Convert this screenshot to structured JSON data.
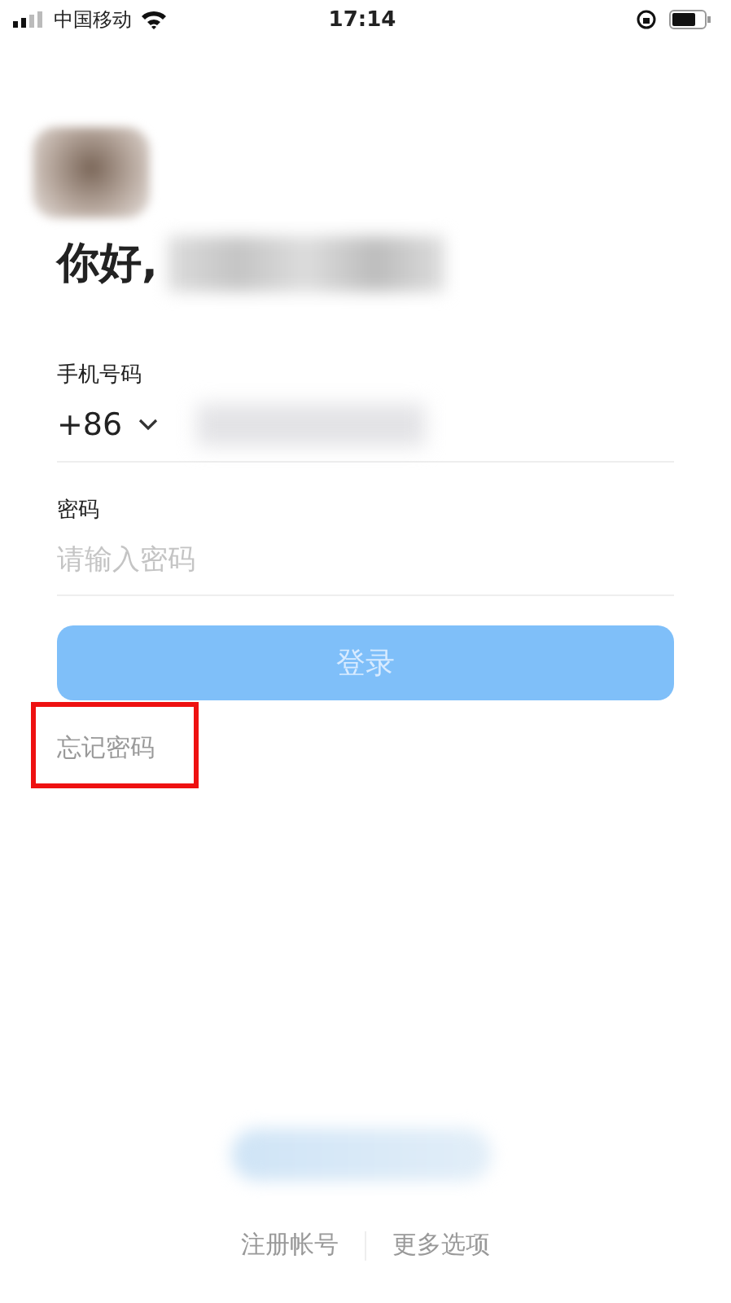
{
  "status_bar": {
    "carrier": "中国移动",
    "time": "17:14"
  },
  "greeting": "你好,",
  "phone": {
    "label": "手机号码",
    "country_code": "+86"
  },
  "password": {
    "label": "密码",
    "placeholder": "请输入密码"
  },
  "login_button": {
    "label": "登录",
    "disabled": true
  },
  "forgot_password": {
    "label": "忘记密码",
    "highlighted": true
  },
  "footer_links": [
    "注册帐号",
    "更多选项"
  ]
}
